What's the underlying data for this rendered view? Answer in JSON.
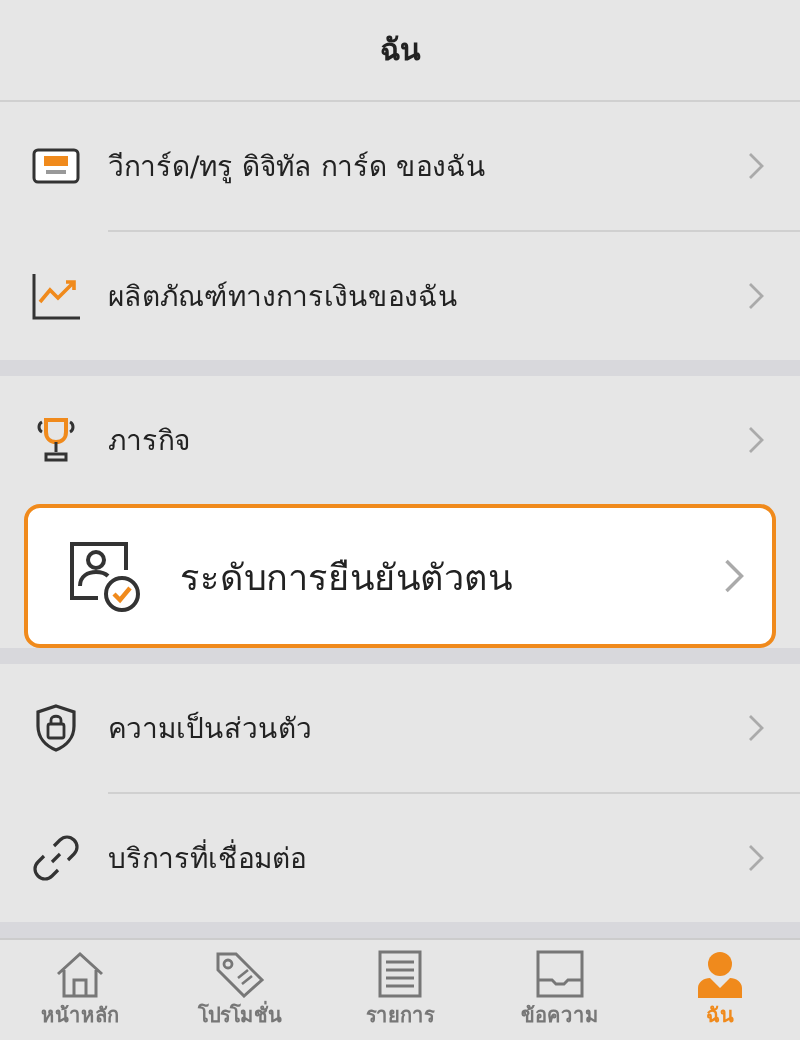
{
  "header": {
    "title": "ฉัน"
  },
  "sections": [
    {
      "items": [
        {
          "label": "วีการ์ด/ทรู ดิจิทัล การ์ด ของฉัน",
          "highlighted": false
        },
        {
          "label": "ผลิตภัณฑ์ทางการเงินของฉัน",
          "highlighted": false
        }
      ]
    },
    {
      "items": [
        {
          "label": "ภารกิจ",
          "highlighted": false
        },
        {
          "label": "ระดับการยืนยันตัวตน",
          "highlighted": true
        }
      ]
    },
    {
      "items": [
        {
          "label": "ความเป็นส่วนตัว",
          "highlighted": false
        },
        {
          "label": "บริการที่เชื่อมต่อ",
          "highlighted": false
        }
      ]
    }
  ],
  "tabs": [
    {
      "label": "หน้าหลัก",
      "selected": false
    },
    {
      "label": "โปรโมชั่น",
      "selected": false
    },
    {
      "label": "รายการ",
      "selected": false
    },
    {
      "label": "ข้อความ",
      "selected": false
    },
    {
      "label": "ฉัน",
      "selected": true
    }
  ]
}
